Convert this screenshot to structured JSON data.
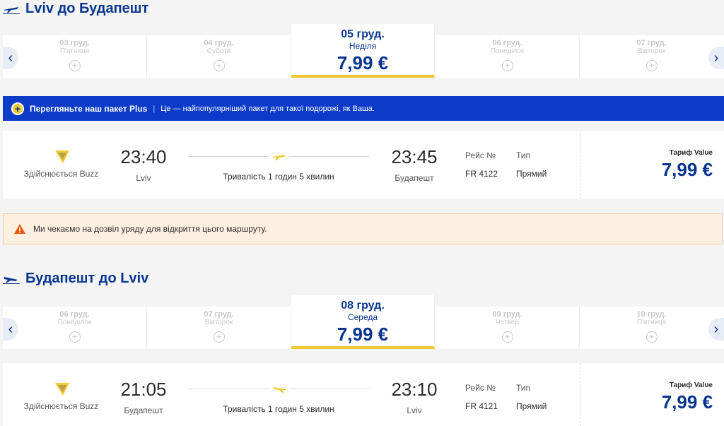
{
  "outbound": {
    "title": "Lviv до Будапешт",
    "dates": [
      {
        "date": "03 груд.",
        "weekday": "П'ятниця",
        "no_flight_icon": "no-flight-icon"
      },
      {
        "date": "04 груд.",
        "weekday": "Субота",
        "no_flight_icon": "no-flight-icon"
      },
      {
        "date": "05 груд.",
        "weekday": "Неділя",
        "price": "7,99 €"
      },
      {
        "date": "06 груд.",
        "weekday": "Понеділок",
        "no_flight_icon": "no-flight-icon"
      },
      {
        "date": "07 груд.",
        "weekday": "Вівторок",
        "no_flight_icon": "no-flight-icon"
      }
    ],
    "flight": {
      "operator": "Здійснюється Buzz",
      "depart_time": "23:40",
      "depart_city": "Lviv",
      "duration": "Тривалість 1 годин 5 хвилин",
      "arrive_time": "23:45",
      "arrive_city": "Будапешт",
      "flight_no_label": "Рейс №",
      "flight_no": "FR 4122",
      "type_label": "Тип",
      "type": "Прямий",
      "fare_label": "Тариф Value",
      "fare": "7,99 €"
    }
  },
  "plus_banner": {
    "title": "Перегляньте наш пакет Plus",
    "separator": "|",
    "text": "Це — найпопулярніший пакет для такої подорожі, як Ваша."
  },
  "warning": {
    "text": "Ми чекаємо на дозвіл уряду для відкриття цього маршруту."
  },
  "inbound": {
    "title": "Будапешт до Lviv",
    "dates": [
      {
        "date": "06 груд.",
        "weekday": "Понеділок",
        "no_flight_icon": "no-flight-icon"
      },
      {
        "date": "07 груд.",
        "weekday": "Вівторок",
        "no_flight_icon": "no-flight-icon"
      },
      {
        "date": "08 груд.",
        "weekday": "Середа",
        "price": "7,99 €"
      },
      {
        "date": "09 груд.",
        "weekday": "Четвер",
        "no_flight_icon": "no-flight-icon"
      },
      {
        "date": "10 груд.",
        "weekday": "П'ятниця",
        "no_flight_icon": "no-flight-icon"
      }
    ],
    "flight": {
      "operator": "Здійснюється Buzz",
      "depart_time": "21:05",
      "depart_city": "Будапешт",
      "duration": "Тривалість 1 годин 5 хвилин",
      "arrive_time": "23:10",
      "arrive_city": "Lviv",
      "flight_no_label": "Рейс №",
      "flight_no": "FR 4121",
      "type_label": "Тип",
      "type": "Прямий",
      "fare_label": "Тариф Value",
      "fare": "7,99 €"
    }
  },
  "colors": {
    "brand_blue": "#073590",
    "accent_yellow": "#f1c933",
    "banner_blue": "#0c3bc9"
  }
}
